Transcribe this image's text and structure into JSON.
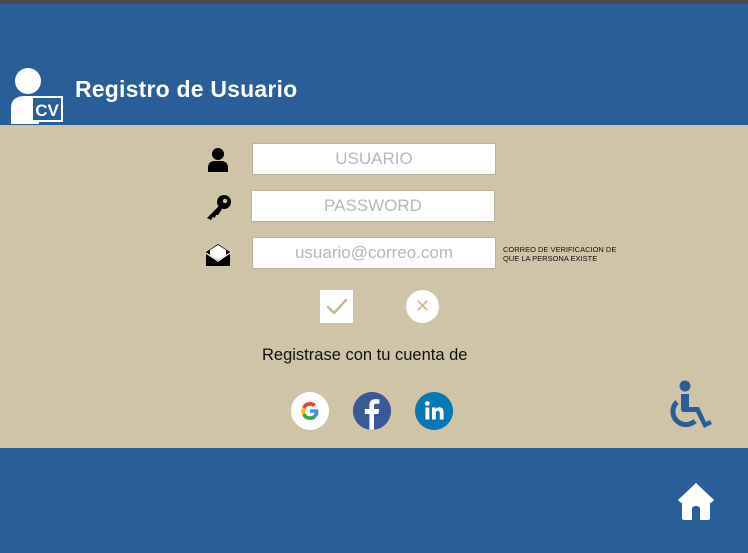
{
  "header": {
    "title": "Registro de Usuario",
    "logo_text": "CV"
  },
  "form": {
    "username": {
      "value": "",
      "placeholder": "USUARIO",
      "icon": "user-icon"
    },
    "password": {
      "value": "",
      "placeholder": "PASSWORD",
      "icon": "key-icon"
    },
    "email": {
      "value": "",
      "placeholder": "usuario@correo.com",
      "icon": "envelope-icon"
    },
    "email_note": "CORREO DE VERIFICACION DE QUE  LA PERSONA EXISTE",
    "confirm_icon": "check-icon",
    "cancel_icon": "close-icon",
    "cancel_glyph": "✕"
  },
  "social": {
    "label": "Registrase con tu cuenta de",
    "google_letter": "G",
    "facebook_letter": "f",
    "linkedin_letters": "in"
  },
  "colors": {
    "header_bg": "#2a5e99",
    "main_bg": "#cfc4a8",
    "google_blue": "#4285f4",
    "google_red": "#ea4335",
    "google_yellow": "#fbbc05",
    "google_green": "#34a853",
    "facebook": "#3b5998",
    "linkedin": "#0a77b5"
  },
  "icons": {
    "accessibility": "wheelchair-icon",
    "home": "home-icon"
  }
}
